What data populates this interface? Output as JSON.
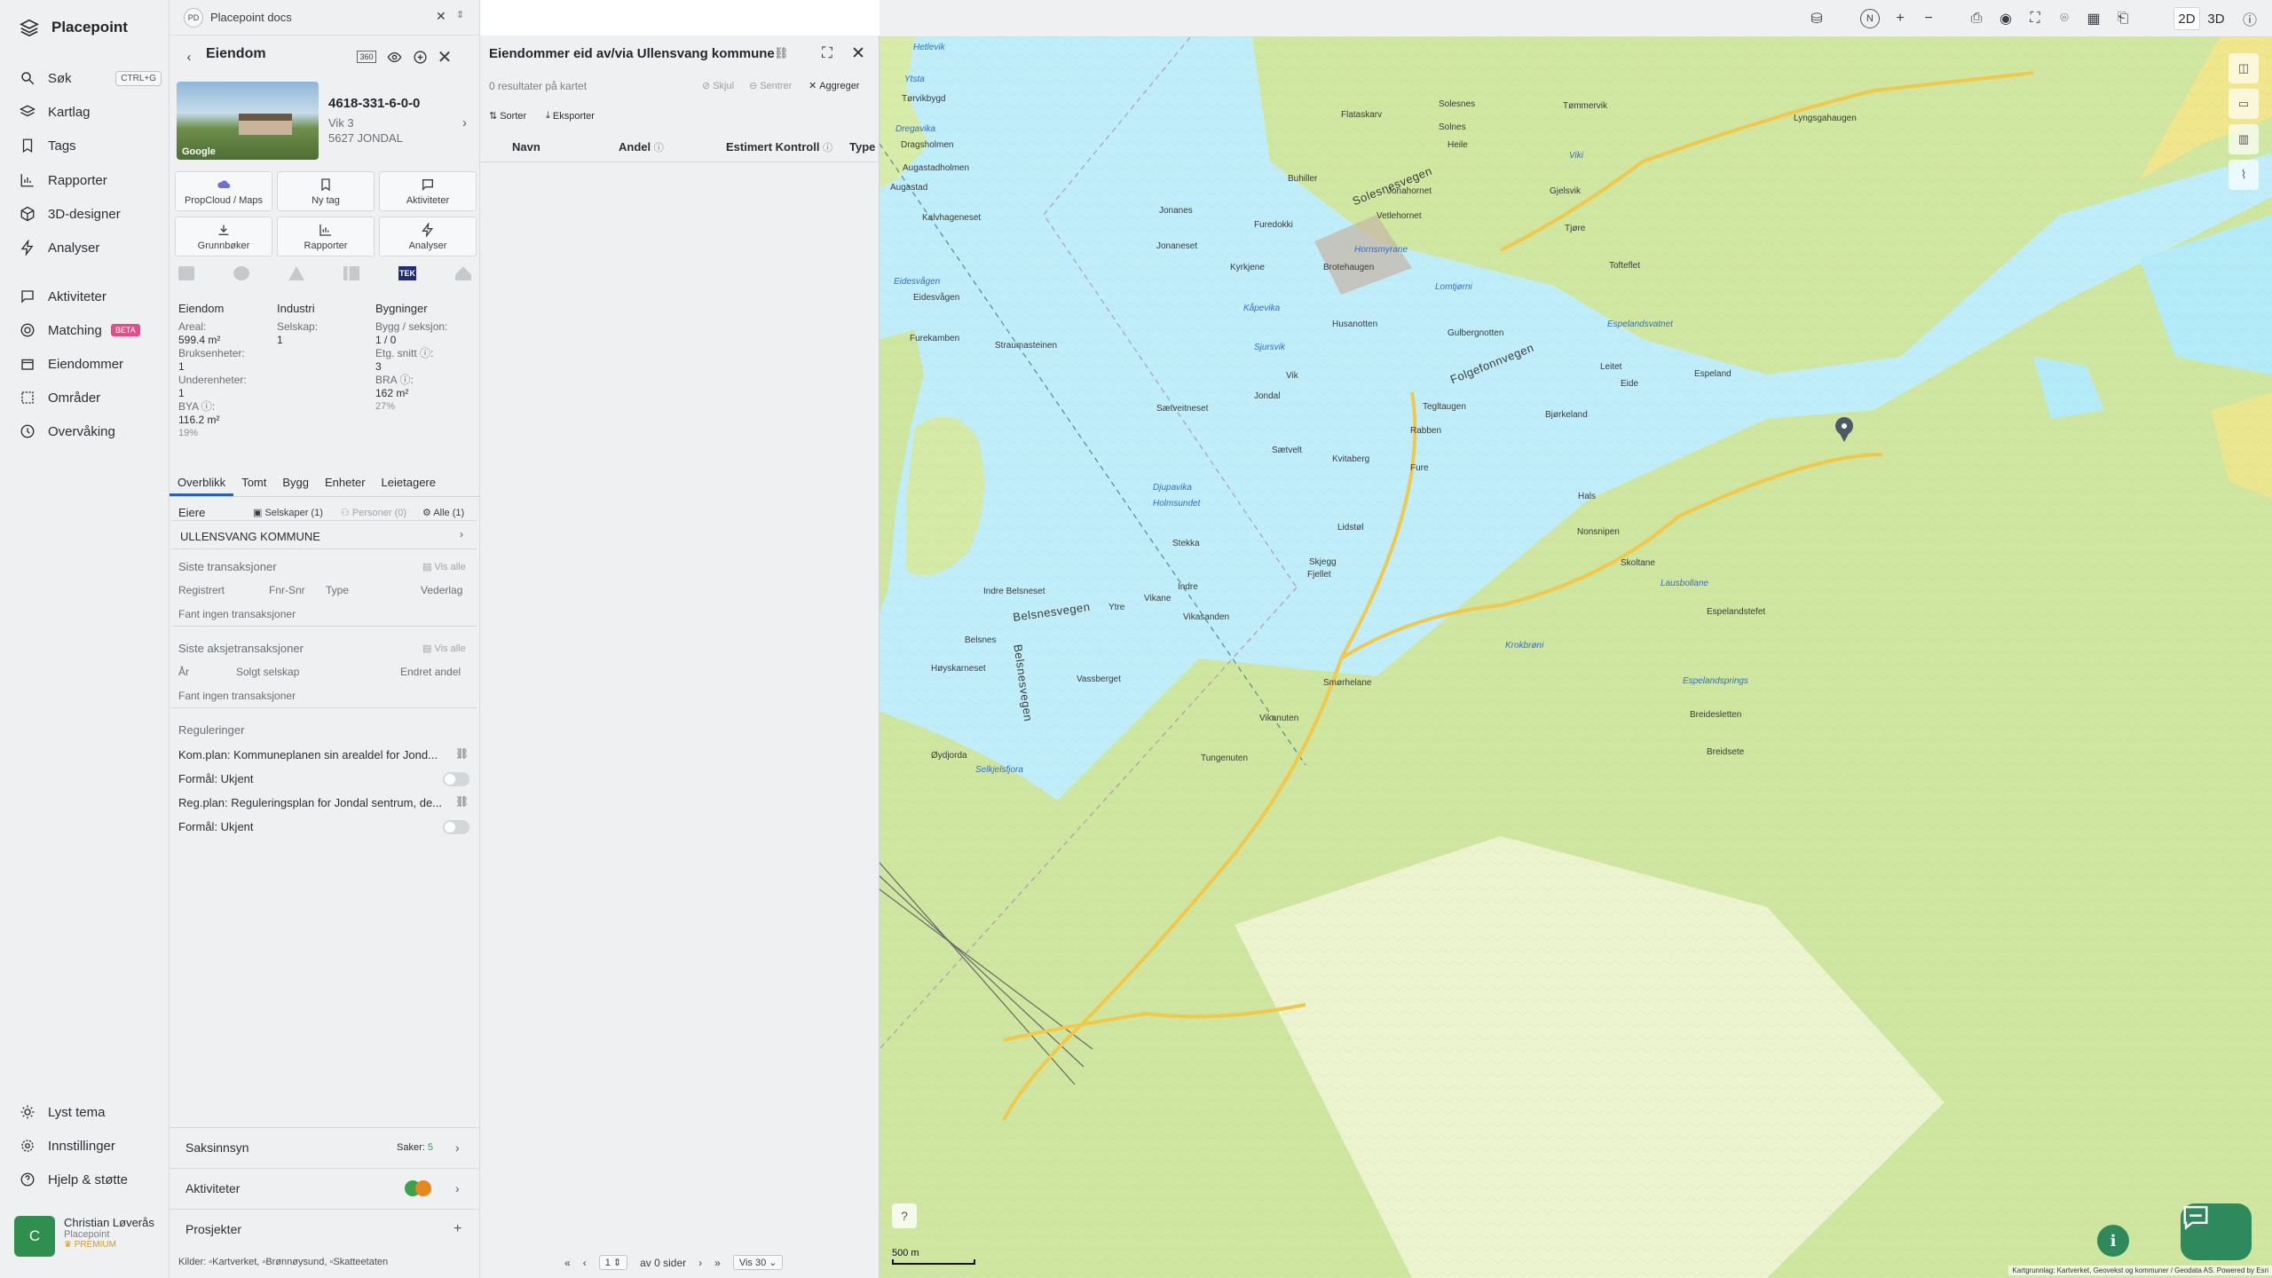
{
  "nav": {
    "brand": "Placepoint",
    "items": [
      {
        "label": "Søk",
        "shortcut": "CTRL+G"
      },
      {
        "label": "Kartlag"
      },
      {
        "label": "Tags"
      },
      {
        "label": "Rapporter"
      },
      {
        "label": "3D-designer"
      },
      {
        "label": "Analyser"
      },
      {
        "label": "Aktiviteter"
      },
      {
        "label": "Matching",
        "badge": "BETA"
      },
      {
        "label": "Eiendommer"
      },
      {
        "label": "Områder"
      },
      {
        "label": "Overvåking"
      }
    ],
    "bottom": [
      {
        "label": "Lyst tema"
      },
      {
        "label": "Innstillinger"
      },
      {
        "label": "Hjelp & støtte"
      }
    ],
    "user": {
      "initial": "C",
      "name": "Christian Løverås",
      "org": "Placepoint",
      "plan": "PREMIUM"
    }
  },
  "doc_bar": {
    "badge": "PD",
    "title": "Placepoint docs"
  },
  "property": {
    "header": "Eiendom",
    "thumb_label": "Google",
    "id": "4618-331-6-0-0",
    "address_lines": [
      "Vik 3",
      "5627 JONDAL"
    ],
    "actions": [
      {
        "label": "PropCloud / Maps",
        "icon": "cloud-icon"
      },
      {
        "label": "Ny tag",
        "icon": "bookmark-icon"
      },
      {
        "label": "Aktiviteter",
        "icon": "chat-icon"
      },
      {
        "label": "Grunnbøker",
        "icon": "download-icon"
      },
      {
        "label": "Rapporter",
        "icon": "bar-chart-icon"
      },
      {
        "label": "Analyser",
        "icon": "bolt-icon"
      }
    ],
    "source_badge": "TEK",
    "facts": {
      "eiendom": {
        "title": "Eiendom",
        "areal_label": "Areal:",
        "areal": "599.4 m²",
        "bruks_label": "Bruksenheter:",
        "bruks": "1",
        "under_label": "Underenheter:",
        "under": "1",
        "bya_label": "BYA ⓘ:",
        "bya": "116.2 m²",
        "bya_pct": "19%"
      },
      "industri": {
        "title": "Industri",
        "selskap_label": "Selskap:",
        "selskap": "1"
      },
      "bygninger": {
        "title": "Bygninger",
        "bygg_label": "Bygg / seksjon:",
        "bygg": "1 / 0",
        "etg_label": "Etg. snitt ⓘ:",
        "etg": "3",
        "bra_label": "BRA ⓘ:",
        "bra": "162 m²",
        "bra_pct": "27%"
      }
    },
    "tabs": [
      "Overblikk",
      "Tomt",
      "Bygg",
      "Enheter",
      "Leietagere"
    ],
    "owners": {
      "label": "Eiere",
      "filters": [
        "Selskaper (1)",
        "Personer (0)",
        "Alle (1)"
      ],
      "name": "ULLENSVANG KOMMUNE"
    },
    "transactions": {
      "label": "Siste transaksjoner",
      "show_all": "Vis alle",
      "columns": [
        "Registrert",
        "Fnr-Snr",
        "Type",
        "Vederlag"
      ],
      "empty": "Fant ingen transaksjoner"
    },
    "share_transactions": {
      "label": "Siste aksjetransaksjoner",
      "show_all": "Vis alle",
      "columns": [
        "År",
        "Solgt selskap",
        "Endret andel"
      ],
      "empty": "Fant ingen transaksjoner"
    },
    "regulations": {
      "label": "Reguleringer",
      "items": [
        {
          "plan": "Kom.plan: Kommuneplanen sin arealdel for Jond...",
          "purpose": "Formål: Ukjent"
        },
        {
          "plan": "Reg.plan: Reguleringsplan for Jondal sentrum, de...",
          "purpose": "Formål: Ukjent"
        }
      ]
    },
    "accordions": [
      {
        "label": "Saksinnsyn",
        "meta_label": "Saker:",
        "meta_value": "5"
      },
      {
        "label": "Aktiviteter"
      },
      {
        "label": "Prosjekter",
        "action": "+"
      }
    ]
  },
  "results": {
    "title": "Eiendommer eid av/via Ullensvang kommune",
    "count_text": "0 resultater på kartet",
    "tools": [
      "Skjul",
      "Sentrer",
      "Aggreger"
    ],
    "sort": "Sorter",
    "export": "Eksporter",
    "columns": [
      "Navn",
      "Andel",
      "Estimert Kontroll",
      "Type"
    ],
    "pager": {
      "page": "1",
      "of": "av 0 sider",
      "per_page": "Vis 30"
    },
    "sources_label": "Kilder:",
    "sources": [
      "Kartverket",
      "Brønnøysund",
      "Skatteetaten"
    ]
  },
  "map_toolbar": {
    "north": "N",
    "mode_2d": "2D",
    "mode_3d": "3D"
  },
  "map": {
    "scale": "500 m",
    "attribution": "Kartgrunnlag: Kartverket, Geovekst og kommuner / Geodata AS. Powered by Esri",
    "labels_land": [
      "Tørvikbygd",
      "Augastadholmen",
      "Augastad",
      "Dragsholmen",
      "Kalvhageneset",
      "Eidesvågen",
      "Furekamben",
      "Straumasteinen",
      "Jonanes",
      "Jonaneset",
      "Furedokki",
      "Kyrkjene",
      "Buhiller",
      "Brotehaugen",
      "Husanotten",
      "Gulbergnotten",
      "Jonahornet",
      "Vetlehornet",
      "Solnes",
      "Flataskarv",
      "Heile",
      "Tømmervik",
      "Solesnes",
      "Sætveitneset",
      "Jondal",
      "Vik",
      "Tegltaugen",
      "Rabben",
      "Kvitaberg",
      "Sætvelt",
      "Stekka",
      "Indre",
      "Ytre",
      "Vikane",
      "Vikasanden",
      "Indre Belsneset",
      "Belsnes",
      "Høyskarneset",
      "Vassberget",
      "Øydjorda",
      "Vikanuten",
      "Tungenuten",
      "Smørhelane",
      "Fjellet",
      "Skjegg",
      "Lidstøl",
      "Fure",
      "Hals",
      "Nonsnipen",
      "Skoltane",
      "Bjørkeland",
      "Eide",
      "Espeland",
      "Espelandstefet",
      "Breidesletten",
      "Breidsete",
      "Gjelsvik",
      "Tjøre",
      "Tofteflet",
      "Leitet",
      "Lyngsgahaugen"
    ],
    "labels_water": [
      "Hetlevik",
      "Ytsta",
      "Dregavika",
      "Eidesvågen",
      "Kåpevika",
      "Sjursvik",
      "Djupavika",
      "Holmsundet",
      "Selkjelsfjora",
      "Hornsmyrane",
      "Lomtjørni",
      "Espelandsvatnet",
      "Folgefonnvegen",
      "Krokbrøni",
      "Lausbollane",
      "Espelandsprings",
      "Viki"
    ],
    "labels_road": [
      "Solesnesvegen",
      "Belsnesvegen",
      "Folgefonnvegen",
      "Belsnesvegen"
    ]
  }
}
